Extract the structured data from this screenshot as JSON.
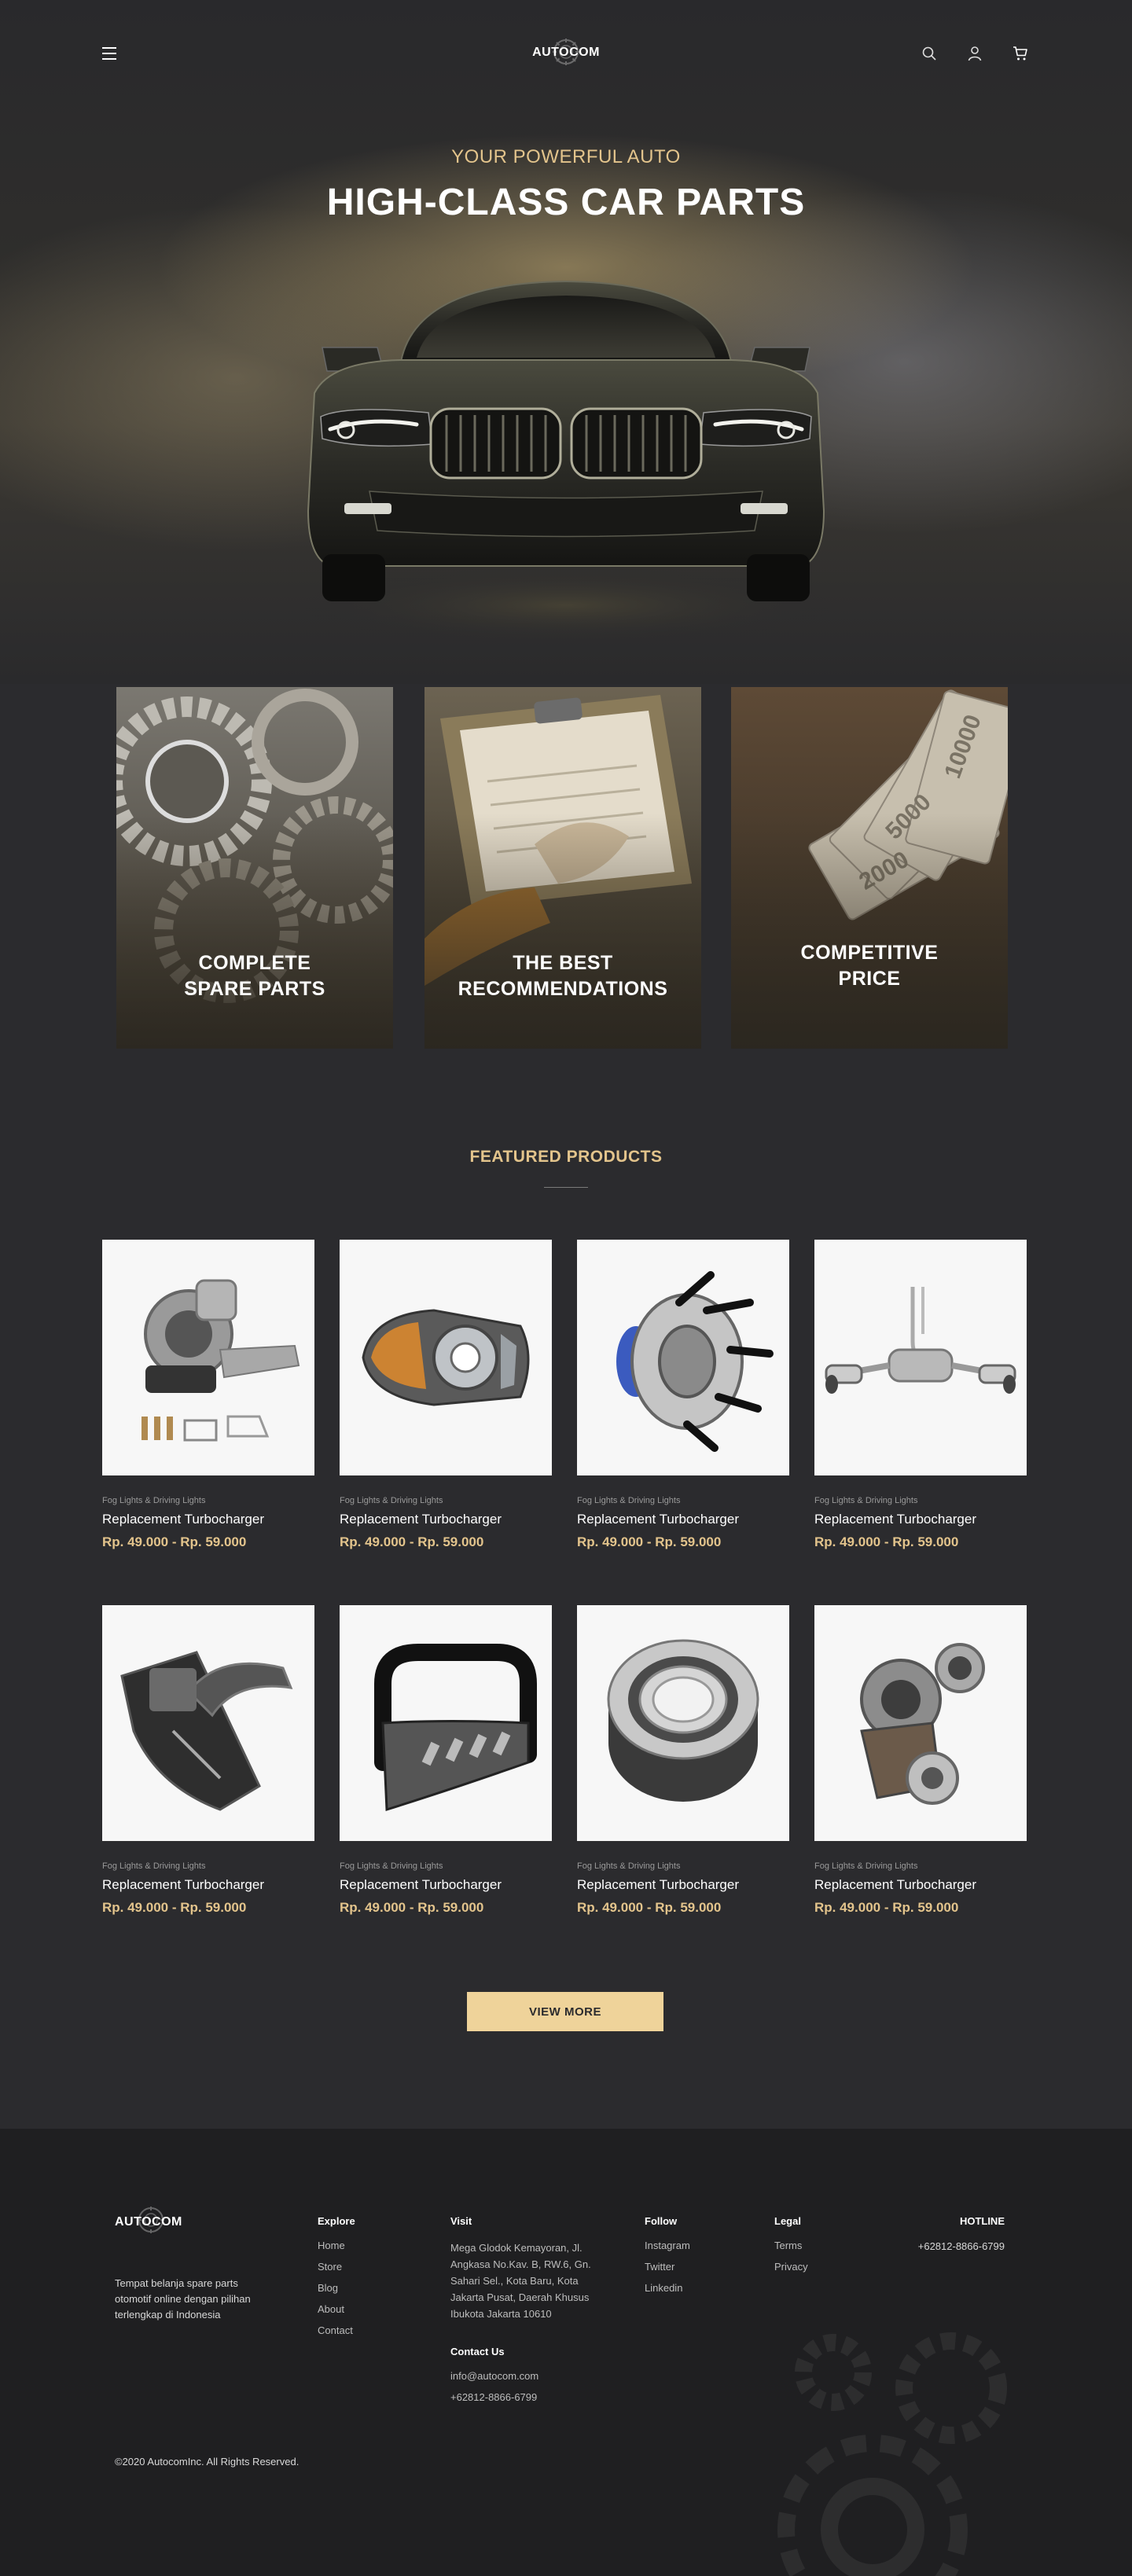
{
  "brand": {
    "name": "AUTOCOM"
  },
  "nav": {
    "menu_icon": "hamburger-icon",
    "icons": [
      "search-icon",
      "user-icon",
      "cart-icon"
    ]
  },
  "hero": {
    "subtitle": "YOUR POWERFUL AUTO",
    "title": "HIGH-CLASS CAR PARTS"
  },
  "features": [
    {
      "line1": "COMPLETE",
      "line2": "SPARE PARTS"
    },
    {
      "line1": "THE BEST",
      "line2": "RECOMMENDATIONS"
    },
    {
      "line1": "COMPETITIVE",
      "line2": "PRICE"
    }
  ],
  "featured": {
    "title": "FEATURED PRODUCTS",
    "products": [
      {
        "category": "Fog Lights & Driving Lights",
        "name": "Replacement Turbocharger",
        "price": "Rp. 49.000 - Rp. 59.000",
        "image": "turbocharger-kit"
      },
      {
        "category": "Fog Lights & Driving Lights",
        "name": "Replacement Turbocharger",
        "price": "Rp. 49.000 - Rp. 59.000",
        "image": "headlight"
      },
      {
        "category": "Fog Lights & Driving Lights",
        "name": "Replacement Turbocharger",
        "price": "Rp. 49.000 - Rp. 59.000",
        "image": "wheel-hub"
      },
      {
        "category": "Fog Lights & Driving Lights",
        "name": "Replacement Turbocharger",
        "price": "Rp. 49.000 - Rp. 59.000",
        "image": "exhaust-system"
      },
      {
        "category": "Fog Lights & Driving Lights",
        "name": "Replacement Turbocharger",
        "price": "Rp. 49.000 - Rp. 59.000",
        "image": "air-intake"
      },
      {
        "category": "Fog Lights & Driving Lights",
        "name": "Replacement Turbocharger",
        "price": "Rp. 49.000 - Rp. 59.000",
        "image": "bull-bar"
      },
      {
        "category": "Fog Lights & Driving Lights",
        "name": "Replacement Turbocharger",
        "price": "Rp. 49.000 - Rp. 59.000",
        "image": "wheel-bearing"
      },
      {
        "category": "Fog Lights & Driving Lights",
        "name": "Replacement Turbocharger",
        "price": "Rp. 49.000 - Rp. 59.000",
        "image": "turbocharger"
      }
    ],
    "view_more": "VIEW MORE"
  },
  "footer": {
    "tagline": "Tempat belanja spare parts otomotif online dengan pilihan terlengkap di Indonesia",
    "explore": {
      "title": "Explore",
      "links": [
        "Home",
        "Store",
        "Blog",
        "About",
        "Contact"
      ]
    },
    "visit": {
      "title": "Visit",
      "address": "Mega Glodok Kemayoran, Jl. Angkasa No.Kav. B, RW.6, Gn. Sahari Sel., Kota Baru, Kota Jakarta Pusat, Daerah Khusus Ibukota Jakarta 10610",
      "contact_title": "Contact Us",
      "email": "info@autocom.com",
      "phone": "+62812-8866-6799"
    },
    "follow": {
      "title": "Follow",
      "links": [
        "Instagram",
        "Twitter",
        "Linkedin"
      ]
    },
    "legal": {
      "title": "Legal",
      "links": [
        "Terms",
        "Privacy"
      ]
    },
    "hotline": {
      "title": "HOTLINE",
      "number": "+62812-8866-6799"
    },
    "copyright": "©2020 AutocomInc. All Rights Reserved."
  },
  "colors": {
    "background": "#2b2b2e",
    "footer": "#1f1f21",
    "accent": "#e3c48c",
    "button": "#efd39a"
  }
}
